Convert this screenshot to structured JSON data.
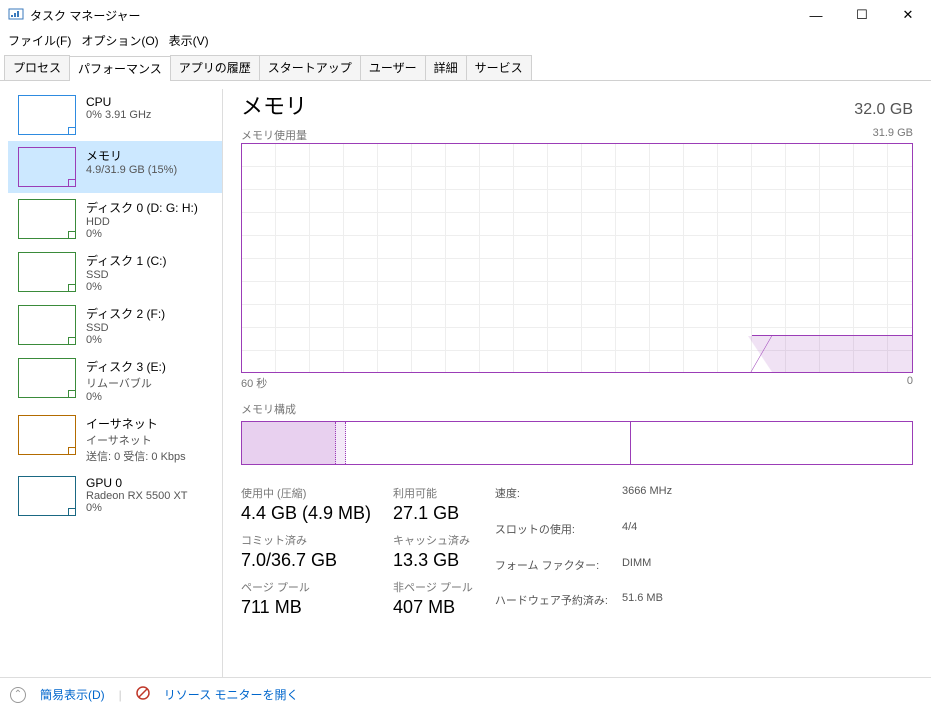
{
  "window": {
    "title": "タスク マネージャー"
  },
  "menu": {
    "file": "ファイル(F)",
    "options": "オプション(O)",
    "view": "表示(V)"
  },
  "tabs": {
    "items": [
      "プロセス",
      "パフォーマンス",
      "アプリの履歴",
      "スタートアップ",
      "ユーザー",
      "詳細",
      "サービス"
    ],
    "active": 1
  },
  "sidebar": {
    "items": [
      {
        "title": "CPU",
        "sub1": "0%  3.91 GHz",
        "sub2": "",
        "type": "cpu"
      },
      {
        "title": "メモリ",
        "sub1": "4.9/31.9 GB (15%)",
        "sub2": "",
        "type": "mem",
        "selected": true
      },
      {
        "title": "ディスク 0 (D: G: H:)",
        "sub1": "HDD",
        "sub2": "0%",
        "type": "disk"
      },
      {
        "title": "ディスク 1 (C:)",
        "sub1": "SSD",
        "sub2": "0%",
        "type": "disk"
      },
      {
        "title": "ディスク 2 (F:)",
        "sub1": "SSD",
        "sub2": "0%",
        "type": "disk"
      },
      {
        "title": "ディスク 3 (E:)",
        "sub1": "リムーバブル",
        "sub2": "0%",
        "type": "disk"
      },
      {
        "title": "イーサネット",
        "sub1": "イーサネット",
        "sub2": "送信: 0 受信: 0 Kbps",
        "type": "eth"
      },
      {
        "title": "GPU 0",
        "sub1": "Radeon RX 5500 XT",
        "sub2": "0%",
        "type": "gpu"
      }
    ]
  },
  "main": {
    "title": "メモリ",
    "total": "32.0 GB",
    "chart_label": "メモリ使用量",
    "chart_max": "31.9 GB",
    "axis_left": "60 秒",
    "axis_right": "0",
    "comp_label": "メモリ構成",
    "stats": {
      "inuse_label": "使用中 (圧縮)",
      "inuse": "4.4 GB (4.9 MB)",
      "avail_label": "利用可能",
      "avail": "27.1 GB",
      "commit_label": "コミット済み",
      "commit": "7.0/36.7 GB",
      "cache_label": "キャッシュ済み",
      "cache": "13.3 GB",
      "paged_label": "ページ プール",
      "paged": "711 MB",
      "nonpaged_label": "非ページ プール",
      "nonpaged": "407 MB"
    },
    "info": {
      "speed_l": "速度:",
      "speed": "3666 MHz",
      "slots_l": "スロットの使用:",
      "slots": "4/4",
      "form_l": "フォーム ファクター:",
      "form": "DIMM",
      "hw_l": "ハードウェア予約済み:",
      "hw": "51.6 MB"
    }
  },
  "chart_data": {
    "type": "line",
    "title": "メモリ使用量",
    "xlabel": "60 秒",
    "ylabel": "",
    "ylim": [
      0,
      31.9
    ],
    "x_range_seconds": [
      60,
      0
    ],
    "series": [
      {
        "name": "使用中",
        "values_approx_gb": 4.9,
        "note": "flat recent usage around 4.9 GB rising from 0 at far right onset"
      }
    ]
  },
  "footer": {
    "toggle": "簡易表示(D)",
    "resmon": "リソース モニターを開く"
  }
}
